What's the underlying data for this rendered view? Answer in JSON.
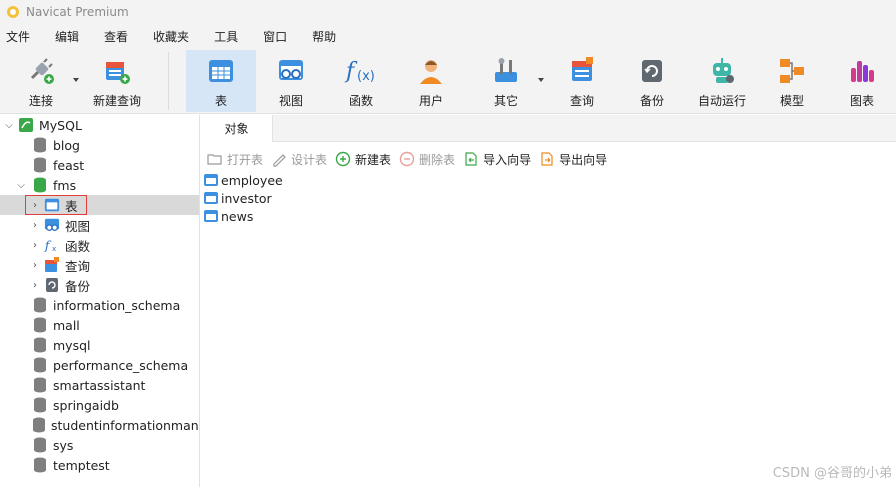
{
  "app": {
    "title": "Navicat Premium"
  },
  "menu": [
    "文件",
    "编辑",
    "查看",
    "收藏夹",
    "工具",
    "窗口",
    "帮助"
  ],
  "toolbar": {
    "connect": "连接",
    "new_query": "新建查询",
    "table": "表",
    "view": "视图",
    "function": "函数",
    "user": "用户",
    "other": "其它",
    "query": "查询",
    "backup": "备份",
    "automation": "自动运行",
    "model": "模型",
    "chart": "图表"
  },
  "sidebar": {
    "connection": "MySQL",
    "databases": {
      "blog": "blog",
      "feast": "feast",
      "fms": "fms",
      "information_schema": "information_schema",
      "mall": "mall",
      "mysql": "mysql",
      "performance_schema": "performance_schema",
      "smartassistant": "smartassistant",
      "springaidb": "springaidb",
      "studentinformationmanag": "studentinformationmanag",
      "sys": "sys",
      "temptest": "temptest"
    },
    "fms_children": {
      "tables": "表",
      "views": "视图",
      "functions": "函数",
      "queries": "查询",
      "backups": "备份"
    }
  },
  "content": {
    "tab": "对象",
    "object_toolbar": {
      "open_table": "打开表",
      "design_table": "设计表",
      "new_table": "新建表",
      "delete_table": "删除表",
      "import_wizard": "导入向导",
      "export_wizard": "导出向导"
    },
    "tables": [
      "employee",
      "investor",
      "news"
    ]
  },
  "watermark": "CSDN @谷哥的小弟",
  "colors": {
    "accent": "#2e7bd6",
    "selected_bg": "#d9d9d9",
    "active_toolbar": "#d6e6f7",
    "highlight_border": "#e0403a"
  }
}
